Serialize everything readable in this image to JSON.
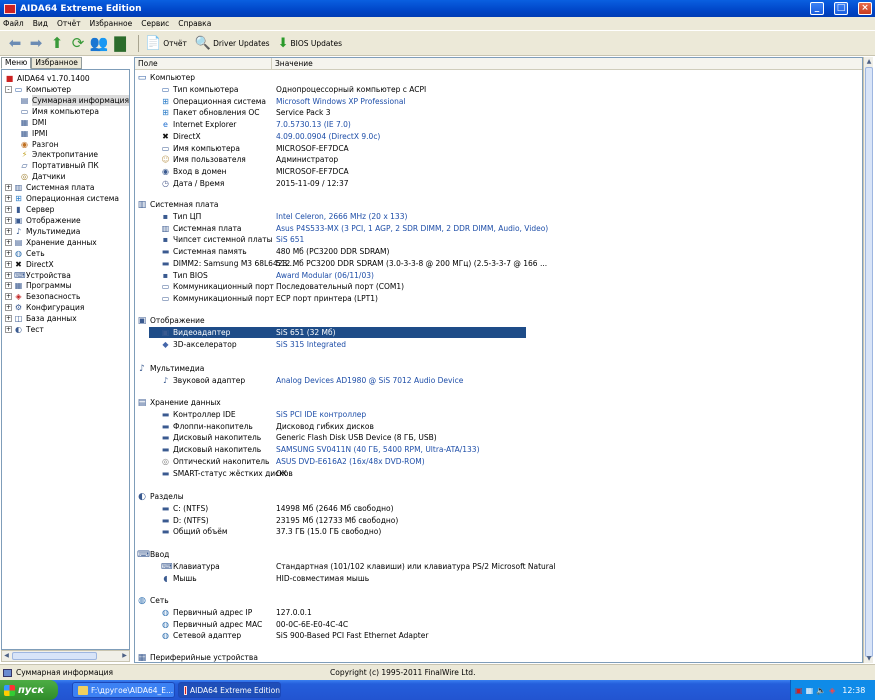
{
  "window": {
    "title": "AIDA64 Extreme Edition"
  },
  "menubar": [
    "Файл",
    "Вид",
    "Отчёт",
    "Избранное",
    "Сервис",
    "Справка"
  ],
  "toolbar": {
    "report": "Отчёт",
    "driver_updates": "Driver Updates",
    "bios_updates": "BIOS Updates"
  },
  "left_tabs": [
    "Меню",
    "Избранное"
  ],
  "tree": [
    {
      "label": "AIDA64 v1.70.1400",
      "icon": "aida64-app-icon",
      "depth": 0,
      "exp": ""
    },
    {
      "label": "Компьютер",
      "icon": "computer-icon",
      "depth": 0,
      "exp": "-"
    },
    {
      "label": "Суммарная информация",
      "icon": "summary-icon",
      "depth": 1,
      "exp": "",
      "selected": true
    },
    {
      "label": "Имя компьютера",
      "icon": "computer-name-icon",
      "depth": 1,
      "exp": ""
    },
    {
      "label": "DMI",
      "icon": "dmi-icon",
      "depth": 1,
      "exp": ""
    },
    {
      "label": "IPMI",
      "icon": "ipmi-icon",
      "depth": 1,
      "exp": ""
    },
    {
      "label": "Разгон",
      "icon": "overclock-icon",
      "depth": 1,
      "exp": ""
    },
    {
      "label": "Электропитание",
      "icon": "power-icon",
      "depth": 1,
      "exp": ""
    },
    {
      "label": "Портативный ПК",
      "icon": "laptop-icon",
      "depth": 1,
      "exp": ""
    },
    {
      "label": "Датчики",
      "icon": "sensor-icon",
      "depth": 1,
      "exp": ""
    },
    {
      "label": "Системная плата",
      "icon": "motherboard-icon",
      "depth": 0,
      "exp": "+"
    },
    {
      "label": "Операционная система",
      "icon": "os-icon",
      "depth": 0,
      "exp": "+"
    },
    {
      "label": "Сервер",
      "icon": "server-icon",
      "depth": 0,
      "exp": "+"
    },
    {
      "label": "Отображение",
      "icon": "display-icon",
      "depth": 0,
      "exp": "+"
    },
    {
      "label": "Мультимедиа",
      "icon": "multimedia-icon",
      "depth": 0,
      "exp": "+"
    },
    {
      "label": "Хранение данных",
      "icon": "storage-icon",
      "depth": 0,
      "exp": "+"
    },
    {
      "label": "Сеть",
      "icon": "network-icon",
      "depth": 0,
      "exp": "+"
    },
    {
      "label": "DirectX",
      "icon": "directx-icon",
      "depth": 0,
      "exp": "+"
    },
    {
      "label": "Устройства",
      "icon": "devices-icon",
      "depth": 0,
      "exp": "+"
    },
    {
      "label": "Программы",
      "icon": "programs-icon",
      "depth": 0,
      "exp": "+"
    },
    {
      "label": "Безопасность",
      "icon": "security-icon",
      "depth": 0,
      "exp": "+"
    },
    {
      "label": "Конфигурация",
      "icon": "config-icon",
      "depth": 0,
      "exp": "+"
    },
    {
      "label": "База данных",
      "icon": "database-icon",
      "depth": 0,
      "exp": "+"
    },
    {
      "label": "Тест",
      "icon": "test-icon",
      "depth": 0,
      "exp": "+"
    }
  ],
  "columns": {
    "field": "Поле",
    "value": "Значение"
  },
  "sections": [
    {
      "title": "Компьютер",
      "icon": "computer-icon",
      "rows": [
        {
          "f": "Тип компьютера",
          "v": "Однопроцессорный компьютер с ACPI",
          "icon": "computer-icon"
        },
        {
          "f": "Операционная система",
          "v": "Microsoft Windows XP Professional",
          "icon": "os-icon",
          "link": true
        },
        {
          "f": "Пакет обновления ОС",
          "v": "Service Pack 3",
          "icon": "os-icon"
        },
        {
          "f": "Internet Explorer",
          "v": "7.0.5730.13 (IE 7.0)",
          "icon": "ie-icon",
          "link": true
        },
        {
          "f": "DirectX",
          "v": "4.09.00.0904 (DirectX 9.0c)",
          "icon": "directx-icon",
          "link": true
        },
        {
          "f": "Имя компьютера",
          "v": "MICROSOF-EF7DCA",
          "icon": "computer-name-icon"
        },
        {
          "f": "Имя пользователя",
          "v": "Администратор",
          "icon": "user-icon"
        },
        {
          "f": "Вход в домен",
          "v": "MICROSOF-EF7DCA",
          "icon": "domain-icon"
        },
        {
          "f": "Дата / Время",
          "v": "2015-11-09 / 12:37",
          "icon": "clock-icon"
        }
      ]
    },
    {
      "title": "Системная плата",
      "icon": "motherboard-icon",
      "rows": [
        {
          "f": "Тип ЦП",
          "v": "Intel Celeron, 2666 MHz (20 x 133)",
          "icon": "cpu-icon",
          "link": true
        },
        {
          "f": "Системная плата",
          "v": "Asus P4S533-MX  (3 PCI, 1 AGP, 2 SDR DIMM, 2 DDR DIMM, Audio, Video)",
          "icon": "motherboard-icon",
          "link": true
        },
        {
          "f": "Чипсет системной платы",
          "v": "SiS 651",
          "icon": "chipset-icon",
          "link": true
        },
        {
          "f": "Системная память",
          "v": "480 Мб  (PC3200 DDR SDRAM)",
          "icon": "memory-icon"
        },
        {
          "f": "DIMM2: Samsung M3 68L6423...",
          "v": "512 Мб PC3200 DDR SDRAM  (3.0-3-3-8 @ 200 МГц)  (2.5-3-3-7 @ 166 ...",
          "icon": "memory-icon"
        },
        {
          "f": "Тип BIOS",
          "v": "Award Modular (06/11/03)",
          "icon": "bios-icon",
          "link": true
        },
        {
          "f": "Коммуникационный порт",
          "v": "Последовательный порт (COM1)",
          "icon": "port-icon"
        },
        {
          "f": "Коммуникационный порт",
          "v": "ECP порт принтера (LPT1)",
          "icon": "port-icon"
        }
      ]
    },
    {
      "title": "Отображение",
      "icon": "display-icon",
      "rows": [
        {
          "f": "Видеоадаптер",
          "v": "SiS 651  (32 Мб)",
          "icon": "video-icon",
          "link": true,
          "selected": true
        },
        {
          "f": "3D-акселератор",
          "v": "SiS 315 Integrated",
          "icon": "3d-icon",
          "link": true
        }
      ]
    },
    {
      "title": "Мультимедиа",
      "icon": "multimedia-icon",
      "rows": [
        {
          "f": "Звуковой адаптер",
          "v": "Analog Devices AD1980 @ SiS 7012 Audio Device",
          "icon": "audio-icon",
          "link": true
        }
      ]
    },
    {
      "title": "Хранение данных",
      "icon": "storage-icon",
      "rows": [
        {
          "f": "Контроллер IDE",
          "v": "SiS PCI IDE контроллер",
          "icon": "ide-icon",
          "link": true
        },
        {
          "f": "Флоппи-накопитель",
          "v": "Дисковод гибких дисков",
          "icon": "floppy-icon"
        },
        {
          "f": "Дисковый накопитель",
          "v": "Generic Flash Disk USB Device  (8 ГБ, USB)",
          "icon": "disk-icon"
        },
        {
          "f": "Дисковый накопитель",
          "v": "SAMSUNG SV0411N  (40 ГБ, 5400 RPM, Ultra-ATA/133)",
          "icon": "disk-icon",
          "link": true
        },
        {
          "f": "Оптический накопитель",
          "v": "ASUS DVD-E616A2  (16x/48x DVD-ROM)",
          "icon": "optical-icon",
          "link": true
        },
        {
          "f": "SMART-статус жёстких дисков",
          "v": "OK",
          "icon": "smart-icon"
        }
      ]
    },
    {
      "title": "Разделы",
      "icon": "partition-icon",
      "rows": [
        {
          "f": "C: (NTFS)",
          "v": "14998 Мб (2646 Мб свободно)",
          "icon": "drive-icon"
        },
        {
          "f": "D: (NTFS)",
          "v": "23195 Мб (12733 Мб свободно)",
          "icon": "drive-icon"
        },
        {
          "f": "Общий объём",
          "v": "37.3 ГБ (15.0 ГБ свободно)",
          "icon": "drive-icon"
        }
      ]
    },
    {
      "title": "Ввод",
      "icon": "input-icon",
      "rows": [
        {
          "f": "Клавиатура",
          "v": "Стандартная (101/102 клавиши) или клавиатура PS/2 Microsoft Natural",
          "icon": "keyboard-icon"
        },
        {
          "f": "Мышь",
          "v": "HID-совместимая мышь",
          "icon": "mouse-icon"
        }
      ]
    },
    {
      "title": "Сеть",
      "icon": "network-icon",
      "rows": [
        {
          "f": "Первичный адрес IP",
          "v": "127.0.0.1",
          "icon": "network-icon"
        },
        {
          "f": "Первичный адрес MAC",
          "v": "00-0C-6E-E0-4C-4C",
          "icon": "network-icon"
        },
        {
          "f": "Сетевой адаптер",
          "v": "SiS 900-Based PCI Fast Ethernet Adapter",
          "icon": "network-icon"
        }
      ]
    },
    {
      "title": "Периферийные устройства",
      "icon": "peripheral-icon",
      "rows": []
    }
  ],
  "status": {
    "left": "Суммарная информация",
    "center": "Copyright (c) 1995-2011 FinalWire Ltd."
  },
  "taskbar": {
    "start": "пуск",
    "items": [
      "F:\\другое\\AIDA64_E...",
      "AIDA64 Extreme Edition"
    ],
    "time": "12:38"
  }
}
